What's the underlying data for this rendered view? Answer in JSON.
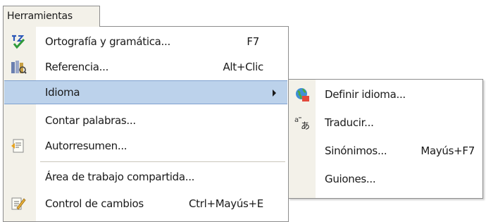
{
  "menu_header": {
    "label": "Herramientas"
  },
  "menu": {
    "items": [
      {
        "label": "Ortografía y gramática...",
        "shortcut": "F7",
        "icon": "spelling-check-icon"
      },
      {
        "label": "Referencia...",
        "shortcut": "Alt+Clic",
        "icon": "reference-books-icon"
      },
      {
        "label": "Idioma",
        "shortcut": "",
        "has_submenu": true,
        "highlighted": true
      },
      {
        "label": "Contar palabras...",
        "shortcut": ""
      },
      {
        "label": "Autorresumen...",
        "shortcut": "",
        "icon": "auto-summary-icon"
      },
      {
        "label": "Área de trabajo compartida...",
        "shortcut": ""
      },
      {
        "label": "Control de cambios",
        "shortcut": "Ctrl+Mayús+E",
        "icon": "track-changes-icon"
      }
    ]
  },
  "submenu": {
    "items": [
      {
        "label": "Definir idioma...",
        "shortcut": "",
        "icon": "globe-language-icon"
      },
      {
        "label": "Traducir...",
        "shortcut": "",
        "icon": "translate-icon"
      },
      {
        "label": "Sinónimos...",
        "shortcut": "Mayús+F7"
      },
      {
        "label": "Guiones...",
        "shortcut": ""
      }
    ]
  },
  "colors": {
    "gutter": "#f3f1e9",
    "highlight": "#bcd2eb",
    "highlight_border": "#7fa1cf",
    "border": "#8d8d8d"
  }
}
